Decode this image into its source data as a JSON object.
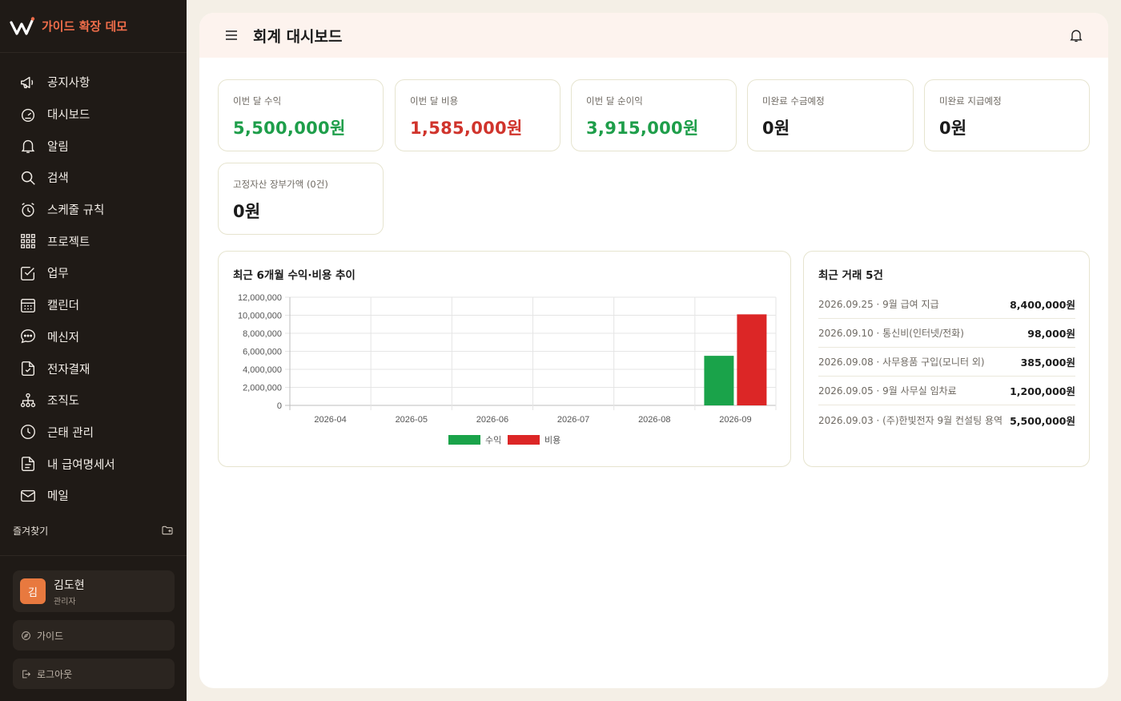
{
  "app": {
    "name": "가이드 확장 데모"
  },
  "sidebar": {
    "items": [
      {
        "label": "공지사항",
        "icon": "megaphone-icon"
      },
      {
        "label": "대시보드",
        "icon": "dashboard-gauge-icon"
      },
      {
        "label": "알림",
        "icon": "bell-icon"
      },
      {
        "label": "검색",
        "icon": "search-icon"
      },
      {
        "label": "스케줄 규칙",
        "icon": "alarm-clock-icon"
      },
      {
        "label": "프로젝트",
        "icon": "grid-icon"
      },
      {
        "label": "업무",
        "icon": "checkbox-icon"
      },
      {
        "label": "캘린더",
        "icon": "calendar-icon"
      },
      {
        "label": "메신저",
        "icon": "chat-bubble-icon"
      },
      {
        "label": "전자결재",
        "icon": "document-check-icon"
      },
      {
        "label": "조직도",
        "icon": "org-chart-icon"
      },
      {
        "label": "근태 관리",
        "icon": "clock-icon"
      },
      {
        "label": "내 급여명세서",
        "icon": "document-text-icon"
      },
      {
        "label": "메일",
        "icon": "mail-icon"
      }
    ],
    "favorites_label": "즐겨찾기",
    "user": {
      "initial": "김",
      "name": "김도현",
      "role": "관리자"
    },
    "guide_label": "가이드",
    "logout_label": "로그아웃"
  },
  "header": {
    "title": "회계 대시보드"
  },
  "stats": [
    {
      "label": "이번 달 수익",
      "value": "5,500,000원",
      "color": "#1e9e4a"
    },
    {
      "label": "이번 달 비용",
      "value": "1,585,000원",
      "color": "#d0342c"
    },
    {
      "label": "이번 달 순이익",
      "value": "3,915,000원",
      "color": "#1e9e4a"
    },
    {
      "label": "미완료 수금예정",
      "value": "0원",
      "color": "#1b1b1b"
    },
    {
      "label": "미완료 지급예정",
      "value": "0원",
      "color": "#1b1b1b"
    },
    {
      "label": "고정자산 장부가액 (0건)",
      "value": "0원",
      "color": "#1b1b1b"
    }
  ],
  "chart_title": "최근 6개월 수익·비용 추이",
  "chart_data": {
    "type": "bar",
    "categories": [
      "2026-04",
      "2026-05",
      "2026-06",
      "2026-07",
      "2026-08",
      "2026-09"
    ],
    "series": [
      {
        "name": "수익",
        "color": "#1aa34a",
        "values": [
          0,
          0,
          0,
          0,
          0,
          5500000
        ]
      },
      {
        "name": "비용",
        "color": "#dc2626",
        "values": [
          0,
          0,
          0,
          0,
          0,
          10100000
        ]
      }
    ],
    "yticks": [
      "0",
      "2,000,000",
      "4,000,000",
      "6,000,000",
      "8,000,000",
      "10,000,000",
      "12,000,000"
    ],
    "ylim": [
      0,
      12000000
    ],
    "grid": true,
    "legend": "bottom-center"
  },
  "transactions": {
    "title": "최근 거래 5건",
    "items": [
      {
        "desc": "2026.09.25 · 9월 급여 지급",
        "amount": "8,400,000원"
      },
      {
        "desc": "2026.09.10 · 통신비(인터넷/전화)",
        "amount": "98,000원"
      },
      {
        "desc": "2026.09.08 · 사무용품 구입(모니터 외)",
        "amount": "385,000원"
      },
      {
        "desc": "2026.09.05 · 9월 사무실 임차료",
        "amount": "1,200,000원"
      },
      {
        "desc": "2026.09.03 · (주)한빛전자 9월 컨설팅 용역",
        "amount": "5,500,000원"
      }
    ]
  }
}
